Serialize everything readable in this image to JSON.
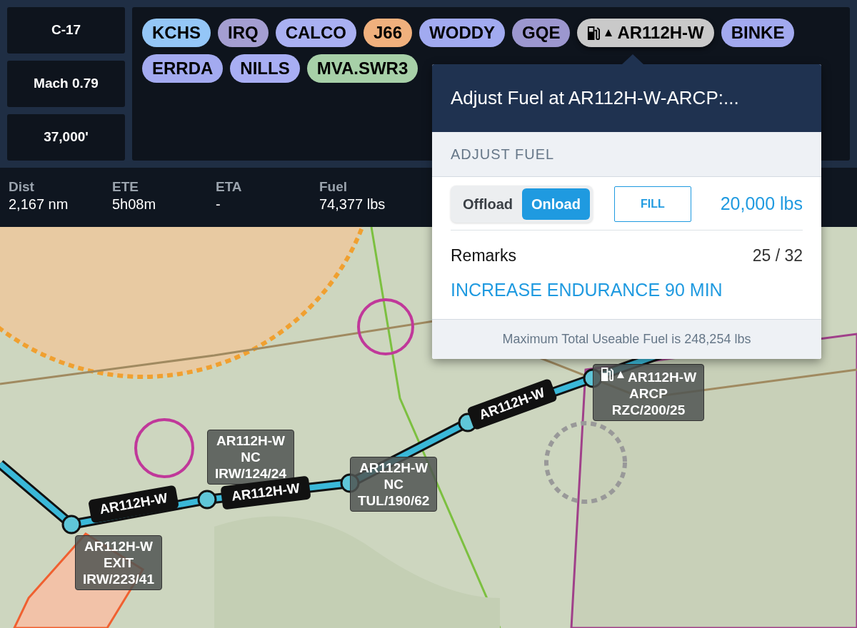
{
  "profile": [
    "C-17",
    "Mach 0.79",
    "37,000'"
  ],
  "route": [
    {
      "label": "KCHS",
      "kind": "waypoint",
      "color": "#94c6f7",
      "selected": false
    },
    {
      "label": "IRQ",
      "kind": "waypoint",
      "color": "#a49ed1",
      "selected": false
    },
    {
      "label": "CALCO",
      "kind": "waypoint",
      "color": "#a9b0f2",
      "selected": false
    },
    {
      "label": "J66",
      "kind": "waypoint",
      "color": "#f0b07d",
      "selected": false
    },
    {
      "label": "WODDY",
      "kind": "waypoint",
      "color": "#a1aaf0",
      "selected": false
    },
    {
      "label": "GQE",
      "kind": "waypoint",
      "color": "#9c97cf",
      "selected": false
    },
    {
      "label": "AR112H-W",
      "kind": "refuel",
      "color": "#c9c9c9",
      "selected": true
    },
    {
      "label": "BINKE",
      "kind": "waypoint",
      "color": "#a2a9ef",
      "selected": false
    },
    {
      "label": "ERRDA",
      "kind": "waypoint",
      "color": "#a3aaf0",
      "selected": false
    },
    {
      "label": "NILLS",
      "kind": "waypoint",
      "color": "#a8aef3",
      "selected": false
    },
    {
      "label": "MVA.SWR3",
      "kind": "waypoint",
      "color": "#a7d0a8",
      "selected": false
    }
  ],
  "stats": [
    {
      "label": "Dist",
      "value": "2,167 nm"
    },
    {
      "label": "ETE",
      "value": "5h08m"
    },
    {
      "label": "ETA",
      "value": "-"
    },
    {
      "label": "Fuel",
      "value": "74,377 lbs"
    }
  ],
  "popover": {
    "title": "Adjust Fuel at AR112H-W-ARCP:...",
    "section": "ADJUST FUEL",
    "modes": [
      {
        "label": "Offload",
        "selected": false
      },
      {
        "label": "Onload",
        "selected": true
      }
    ],
    "fill_button": "FILL",
    "amount": "20,000 lbs",
    "remarks_label": "Remarks",
    "remarks_count": "25 / 32",
    "remarks_text": "INCREASE ENDURANCE 90 MIN",
    "footer": "Maximum Total Useable Fuel is 248,254 lbs"
  },
  "map": {
    "callouts": [
      {
        "lines": [
          "AR112H-W",
          "EXIT",
          "IRW/223/41"
        ],
        "refuel": false
      },
      {
        "lines": [
          "AR112H-W",
          "NC",
          "IRW/124/24"
        ],
        "refuel": false
      },
      {
        "lines": [
          "AR112H-W",
          "NC",
          "TUL/190/62"
        ],
        "refuel": false
      },
      {
        "lines": [
          "AR112H-W",
          "ARCP",
          "RZC/200/25"
        ],
        "refuel": true
      }
    ],
    "leg_labels": [
      "AR112H-W",
      "AR112H-W",
      "AR112H-W"
    ]
  }
}
